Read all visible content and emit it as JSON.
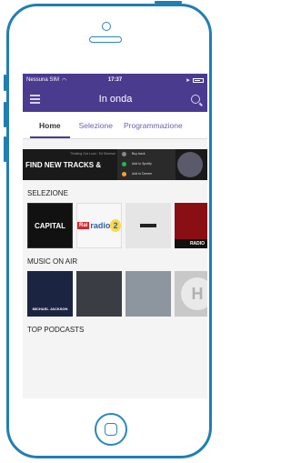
{
  "status": {
    "carrier": "Nessuna SIM",
    "time": "17:37"
  },
  "nav": {
    "title": "In onda"
  },
  "tabs": [
    "Home",
    "Selezione",
    "Programmazione"
  ],
  "banner": {
    "sub": "Thinking Out Loud · Ed Sheeran",
    "headline": "FIND NEW TRACKS &",
    "menu": [
      "Buy track",
      "Add to Spotify",
      "Add to Deezer"
    ]
  },
  "sections": {
    "selezione": "SELEZIONE",
    "music": "MUSIC ON AIR",
    "podcasts": "TOP PODCASTS"
  },
  "selezione_items": {
    "capital": "CAPITAL",
    "rai": "Rai",
    "rai_label": "radio",
    "rai_num": "2",
    "virgin": "RADIO"
  },
  "music_items": {
    "mj": "MICHAEL JACKSON",
    "h": "H"
  },
  "colors": {
    "accent": "#4b3b8e",
    "phone_outline": "#1f7fb3"
  }
}
